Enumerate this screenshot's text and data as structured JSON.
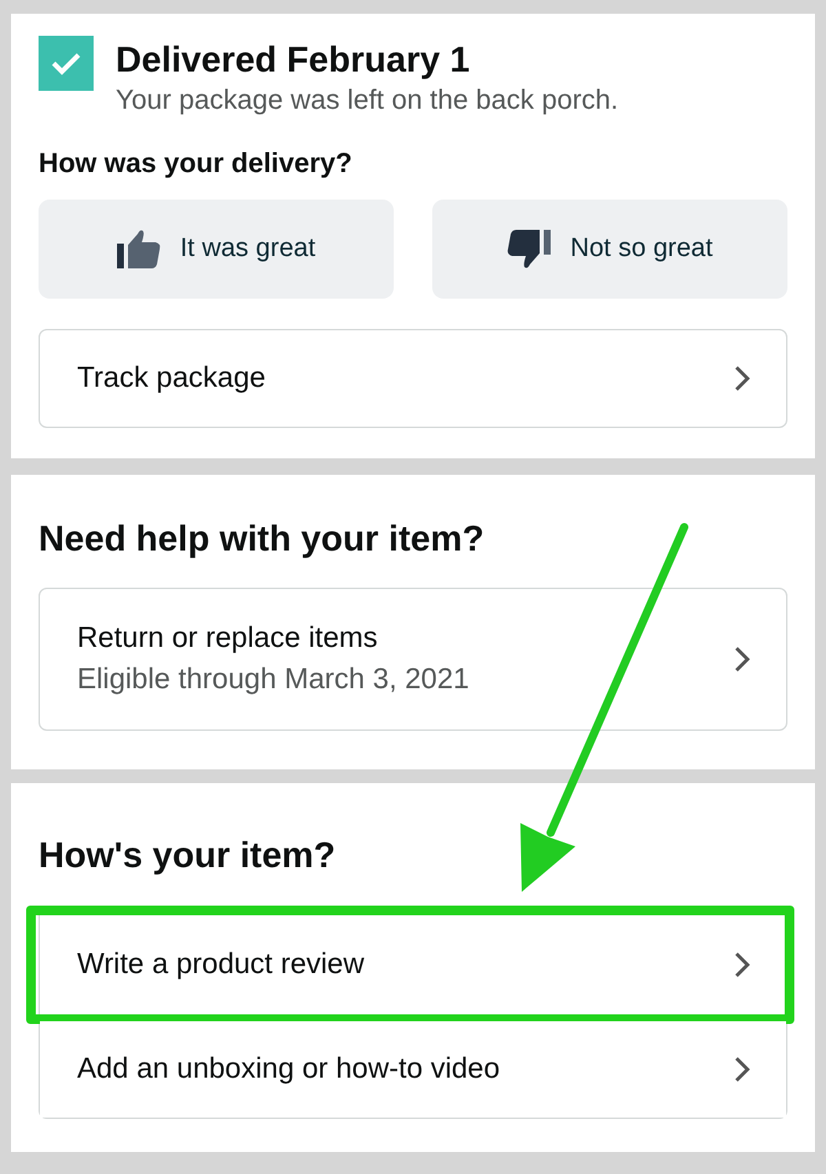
{
  "delivery": {
    "checked": true,
    "title": "Delivered February 1",
    "subtitle": "Your package was left on the back porch.",
    "question": "How was your delivery?",
    "feedback": [
      {
        "kind": "up",
        "label": "It was great"
      },
      {
        "kind": "down",
        "label": "Not so great"
      }
    ],
    "track": "Track package"
  },
  "help": {
    "heading": "Need help with your item?",
    "title": "Return or replace items",
    "subtitle": "Eligible through March 3, 2021"
  },
  "item": {
    "heading": "How's your item?",
    "rows": [
      {
        "label": "Write a product review",
        "highlighted": true
      },
      {
        "label": "Add an unboxing or how-to video",
        "highlighted": false
      }
    ]
  }
}
